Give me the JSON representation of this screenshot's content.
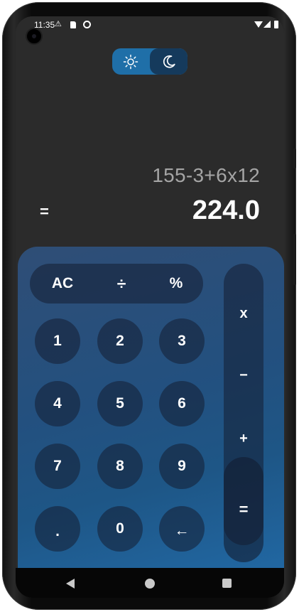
{
  "status_bar": {
    "time": "11:35",
    "icons": [
      "warning-icon",
      "sd-card-icon",
      "do-not-disturb-icon",
      "wifi-icon",
      "signal-icon",
      "battery-icon"
    ]
  },
  "theme_toggle": {
    "options": [
      "light",
      "dark"
    ],
    "selected": "dark",
    "light_icon": "sun-icon",
    "dark_icon": "moon-icon",
    "colors": {
      "track": "#1f6fa8",
      "active": "#153a5c"
    }
  },
  "display": {
    "expression": "155-3+6x12",
    "equals": "=",
    "result": "224.0"
  },
  "keypad": {
    "top_row": [
      "AC",
      "÷",
      "%"
    ],
    "operators": [
      "x",
      "−",
      "+"
    ],
    "equals": "=",
    "rows": [
      [
        "1",
        "2",
        "3"
      ],
      [
        "4",
        "5",
        "6"
      ],
      [
        "7",
        "8",
        "9"
      ],
      [
        ".",
        "0",
        "←"
      ]
    ]
  },
  "nav_bar": {
    "buttons": [
      "back-icon",
      "home-icon",
      "recents-icon"
    ]
  },
  "colors": {
    "background": "#2b2b2b",
    "keypad_gradient_start": "#2f4e76",
    "keypad_gradient_end": "#2167a2",
    "expression_text": "#a5a5a5",
    "result_text": "#ffffff"
  }
}
